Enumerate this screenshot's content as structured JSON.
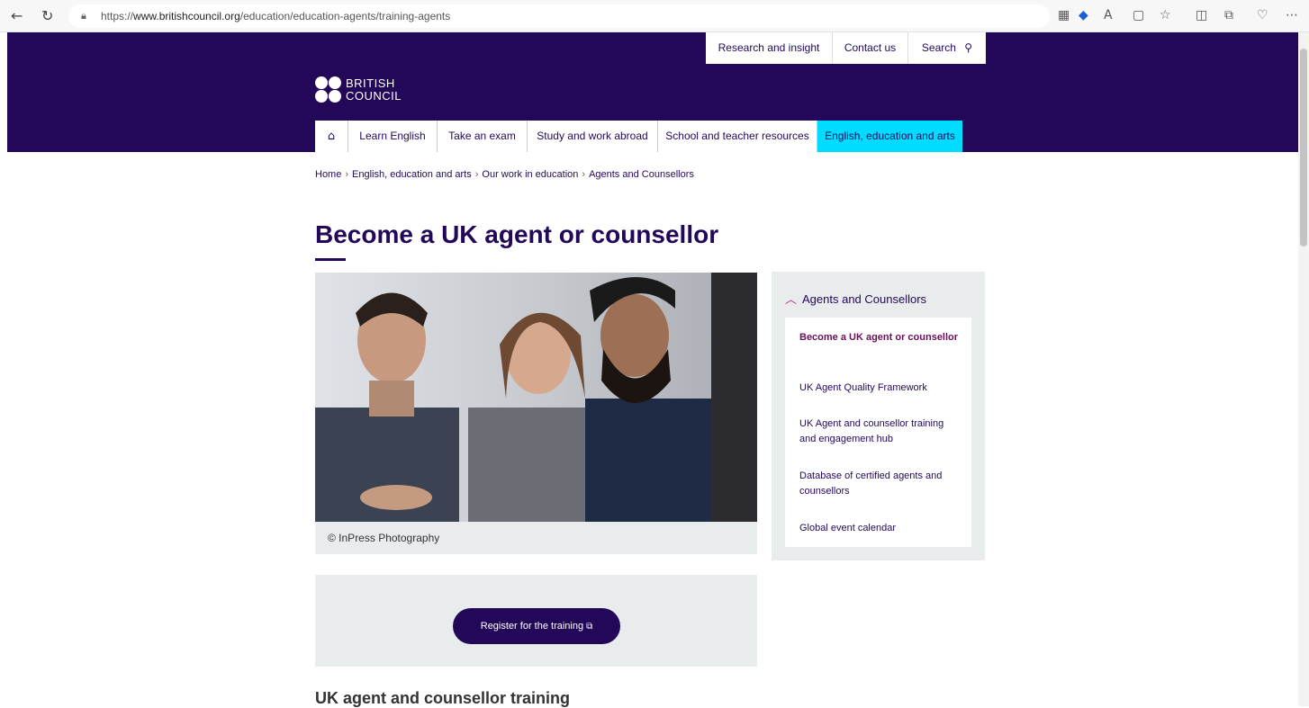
{
  "browser": {
    "url_prefix": "https://",
    "url_domain": "www.britishcouncil.org",
    "url_path": "/education/education-agents/training-agents"
  },
  "utility_nav": {
    "research": "Research and insight",
    "contact": "Contact us",
    "search": "Search"
  },
  "logo": {
    "line1": "BRITISH",
    "line2": "COUNCIL"
  },
  "main_nav": {
    "learn": "Learn English",
    "exam": "Take an exam",
    "study": "Study and work abroad",
    "school": "School and teacher resources",
    "arts": "English, education and arts"
  },
  "breadcrumb": {
    "home": "Home",
    "arts": "English, education and arts",
    "work": "Our work in education",
    "agents": "Agents and Counsellors"
  },
  "page": {
    "title": "Become a UK agent or counsellor",
    "caption": "© InPress Photography",
    "cta": "Register for the training",
    "section_title": "UK agent and counsellor training"
  },
  "sidebar": {
    "heading": "Agents and Counsellors",
    "items": [
      "Become a UK agent or counsellor",
      "UK Agent Quality Framework",
      "UK Agent and counsellor training and engagement hub",
      "Database of certified agents and counsellors",
      "Global event calendar"
    ]
  }
}
